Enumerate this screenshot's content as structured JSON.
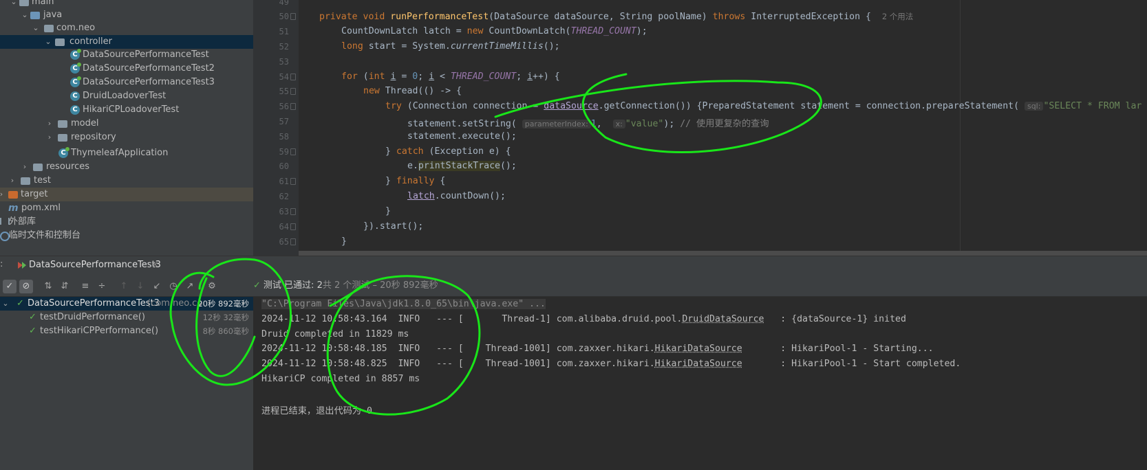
{
  "project_tree": {
    "items": [
      {
        "label": "main"
      },
      {
        "label": "java"
      },
      {
        "label": "com.neo"
      },
      {
        "label": "controller"
      },
      {
        "label": "DataSourcePerformanceTest"
      },
      {
        "label": "DataSourcePerformanceTest2"
      },
      {
        "label": "DataSourcePerformanceTest3"
      },
      {
        "label": "DruidLoadoverTest"
      },
      {
        "label": "HikariCPLoadoverTest"
      },
      {
        "label": "model"
      },
      {
        "label": "repository"
      },
      {
        "label": "ThymeleafApplication"
      },
      {
        "label": "resources"
      },
      {
        "label": "test"
      },
      {
        "label": "target"
      },
      {
        "label": "pom.xml"
      },
      {
        "label": "外部库"
      },
      {
        "label": "临时文件和控制台"
      }
    ]
  },
  "editor": {
    "line_numbers": [
      "49",
      "50",
      "51",
      "52",
      "53",
      "54",
      "55",
      "56",
      "57",
      "58",
      "59",
      "60",
      "61",
      "62",
      "63",
      "64",
      "65"
    ],
    "usage_hint": "2 个用法",
    "param_hints": {
      "sql": "sql:",
      "parameterIndex": "parameterIndex:",
      "x": "x:"
    },
    "code": {
      "l50": {
        "mod": "private void ",
        "name": "runPerformanceTest",
        "a": "(DataSource dataSource, String poolName) ",
        "throws": "throws",
        "b": " InterruptedException {  "
      },
      "l51": {
        "a": "CountDownLatch latch = ",
        "new": "new",
        "b": " CountDownLatch(",
        "c": "THREAD_COUNT",
        "d": ");"
      },
      "l52": {
        "kw": "long",
        "a": " start = System.",
        "b": "currentTimeMillis",
        "c": "();"
      },
      "l54": {
        "kw": "for",
        "a": " (",
        "int": "int",
        "b": " ",
        "i1": "i",
        "c": " = ",
        "zero": "0",
        "d": "; ",
        "i2": "i",
        "e": " < ",
        "tc": "THREAD_COUNT",
        "f": "; ",
        "i3": "i",
        "g": "++) {"
      },
      "l55": {
        "new": "new",
        "a": " Thread(() -> {"
      },
      "l56": {
        "try": "try",
        "a": " (Connection connection = ",
        "ds": "dataSource",
        "b": ".getConnection()) {PreparedStatement statement = connection.prepareStatement( ",
        "s": "\"SELECT * FROM lar"
      },
      "l57": {
        "a": "statement.setString( ",
        "one": "1",
        "b": ",  ",
        "v": "\"value\"",
        "c": "); ",
        "cm": "// 使用更复杂的查询"
      },
      "l58": {
        "a": "statement.execute();"
      },
      "l59": {
        "a": "} ",
        "catch": "catch",
        "b": " (Exception e) {"
      },
      "l60": {
        "a": "e.",
        "b": "printStackTrace",
        "c": "();"
      },
      "l61": {
        "a": "} ",
        "finally": "finally",
        "b": " {"
      },
      "l62": {
        "latch": "latch",
        "a": ".countDown();"
      },
      "l63": {
        "a": "}"
      },
      "l64": {
        "a": "}).start();"
      },
      "l65": {
        "a": "}"
      }
    }
  },
  "run_panel": {
    "tab_label": "DataSourcePerformanceTest3",
    "status": {
      "prefix": "测试 已通过: ",
      "count": "2",
      "suffix": "共 2 个测试 – 20秒 892毫秒"
    },
    "tests": [
      {
        "name": "DataSourcePerformanceTest3",
        "extra": "(com.neo.co",
        "time": "20秒 892毫秒"
      },
      {
        "name": "testDruidPerformance()",
        "time": "12秒 32毫秒"
      },
      {
        "name": "testHikariCPPerformance()",
        "time": "8秒 860毫秒"
      }
    ],
    "console": {
      "cmd": "\"C:\\Program Files\\Java\\jdk1.8.0_65\\bin\\java.exe\" ...",
      "lines": [
        {
          "a": "2024-11-12 10:58:43.164  INFO   --- [       Thread-1] com.alibaba.druid.pool.",
          "b": "DruidDataSource",
          "c": "   : {dataSource-1} inited"
        },
        {
          "a": "Druid completed in 11829 ms"
        },
        {
          "a": "2024-11-12 10:58:48.185  INFO   --- [    Thread-1001] com.zaxxer.hikari.",
          "b": "HikariDataSource",
          "c": "       : HikariPool-1 - Starting..."
        },
        {
          "a": "2024-11-12 10:58:48.825  INFO   --- [    Thread-1001] com.zaxxer.hikari.",
          "b": "HikariDataSource",
          "c": "       : HikariPool-1 - Start completed."
        },
        {
          "a": "HikariCP completed in 8857 ms"
        },
        {
          "a": "进程已结束，退出代码为 0"
        }
      ]
    }
  },
  "colors": {
    "annotation": "#19e619",
    "keyword": "#cc7832",
    "method": "#ffc66d",
    "constant": "#9876aa",
    "string": "#6a8759",
    "pass": "#5fb552"
  },
  "icons": [
    "chevron-down-icon",
    "chevron-right-icon",
    "folder-icon",
    "package-icon",
    "class-icon",
    "spring-class-icon",
    "maven-icon",
    "library-icon",
    "console-icon",
    "check-icon",
    "stop-icon",
    "sort-icon",
    "expand-icon",
    "collapse-icon",
    "up-icon",
    "down-icon",
    "import-icon",
    "history-icon",
    "export-icon",
    "settings-icon",
    "close-icon",
    "run-icon"
  ]
}
